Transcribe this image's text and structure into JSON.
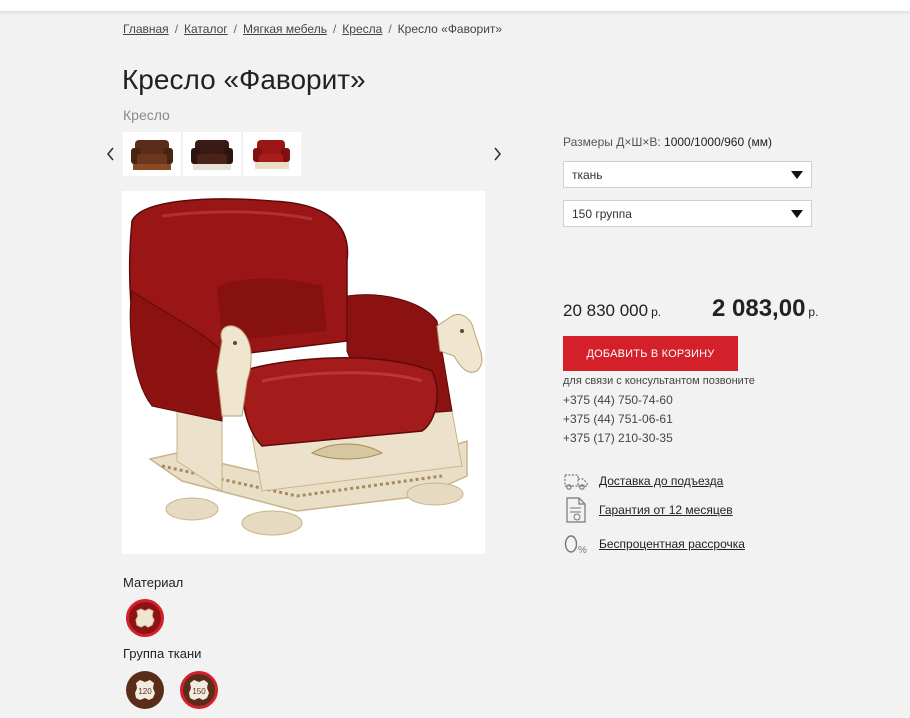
{
  "breadcrumb": {
    "items": [
      "Главная",
      "Каталог",
      "Мягкая мебель",
      "Кресла"
    ],
    "current": "Кресло «Фаворит»"
  },
  "product": {
    "title": "Кресло «Фаворит»",
    "category": "Кресло",
    "gallery": [
      "thumb-brown-leather",
      "thumb-dark-brown-white",
      "thumb-red-leather"
    ]
  },
  "options": {
    "dimensions_label": "Размеры Д×Ш×В:",
    "dimensions_value": "1000/1000/960 (мм)",
    "material_select": "ткань",
    "group_select": "150 группа"
  },
  "pricing": {
    "old_price": "20 830 000",
    "new_price": "2 083,00",
    "currency": "р.",
    "add_to_cart": "Добавить в корзину"
  },
  "contact": {
    "label": "для связи с консультантом позвоните",
    "phones": [
      "+375 (44) 750-74-60",
      "+375 (44) 751-06-61",
      "+375 (17) 210-30-35"
    ]
  },
  "features": [
    {
      "icon": "truck-icon",
      "label": "Доставка до подъезда"
    },
    {
      "icon": "document-icon",
      "label": "Гарантия от 12 месяцев"
    },
    {
      "icon": "zero-percent-icon",
      "label": "Беспроцентная рассрочка"
    }
  ],
  "material": {
    "label": "Материал"
  },
  "fabric_group": {
    "label": "Группа ткани",
    "options": [
      "120",
      "150"
    ],
    "selected": "150"
  },
  "colors": {
    "accent": "#d4202a",
    "leather_red": "#8e1414",
    "leather_brown": "#5a2d1a",
    "cream": "#efe6d2"
  }
}
